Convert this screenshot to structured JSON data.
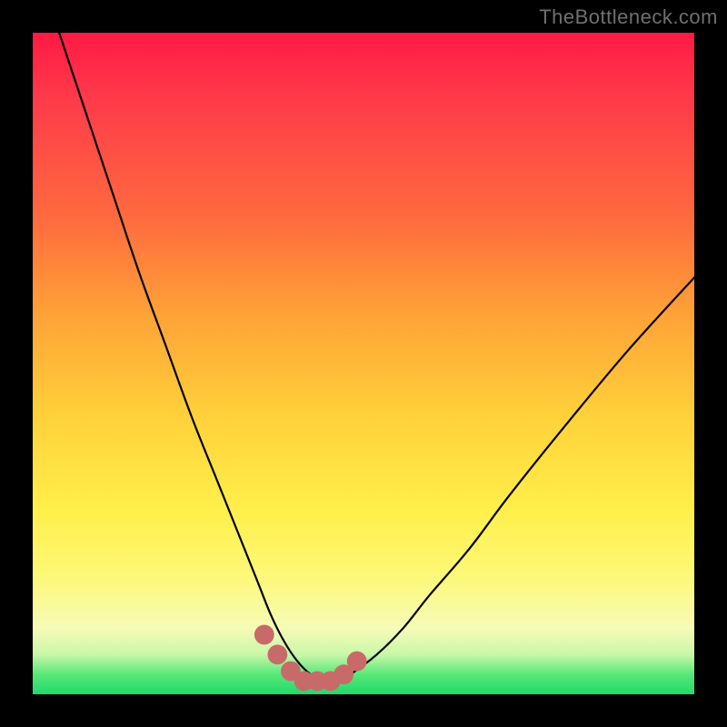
{
  "watermark": {
    "text": "TheBottleneck.com"
  },
  "colors": {
    "background": "#000000",
    "curve": "#000000",
    "marker": "#c96a6a",
    "gradient_top": "#ff1a44",
    "gradient_bottom": "#22d86a"
  },
  "chart_data": {
    "type": "line",
    "title": "",
    "xlabel": "",
    "ylabel": "",
    "xlim": [
      0,
      100
    ],
    "ylim": [
      0,
      100
    ],
    "grid": false,
    "legend": false,
    "series": [
      {
        "name": "bottleneck-curve",
        "x": [
          4,
          8,
          12,
          16,
          20,
          24,
          28,
          32,
          34,
          36,
          38,
          40,
          42,
          44,
          46,
          48,
          52,
          56,
          60,
          66,
          72,
          80,
          90,
          100
        ],
        "values": [
          100,
          88,
          76,
          64,
          53,
          42,
          32,
          22,
          17,
          12,
          8,
          5,
          3,
          2,
          2,
          3,
          6,
          10,
          15,
          22,
          30,
          40,
          52,
          63
        ]
      }
    ],
    "markers": {
      "name": "optimal-range",
      "x": [
        35,
        37,
        39,
        41,
        43,
        45,
        47,
        49
      ],
      "values": [
        9,
        6,
        3.5,
        2,
        2,
        2,
        3,
        5
      ],
      "radius": 1.5
    }
  }
}
